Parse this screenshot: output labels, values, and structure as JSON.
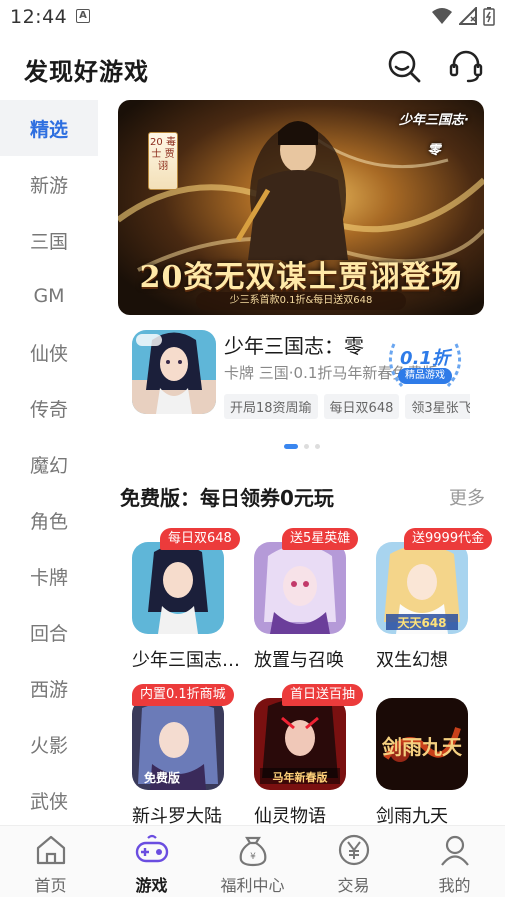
{
  "status_bar": {
    "time": "12:44",
    "notification_letter": "A"
  },
  "header": {
    "title": "发现好游戏"
  },
  "sidebar": {
    "items": [
      {
        "label": "精选",
        "active": true
      },
      {
        "label": "新游"
      },
      {
        "label": "三国"
      },
      {
        "label": "GM"
      },
      {
        "label": "仙侠"
      },
      {
        "label": "传奇"
      },
      {
        "label": "魔幻"
      },
      {
        "label": "角色"
      },
      {
        "label": "卡牌"
      },
      {
        "label": "回合"
      },
      {
        "label": "西游"
      },
      {
        "label": "火影"
      },
      {
        "label": "武侠"
      }
    ]
  },
  "banner": {
    "title": "20资无双谋士贾诩登场",
    "subtitle": "少三系首款0.1折&每日送双648",
    "badge": "20 毒士 贾诩",
    "logo": "少年三国志·零"
  },
  "featured": {
    "name": "少年三国志：零",
    "description": "卡牌 三国·0.1折马年新春免费版",
    "tags": [
      "开局18资周瑜",
      "每日双648",
      "领3星张飞"
    ],
    "discount": "0.1折",
    "discount_label": "精品游戏"
  },
  "carousel": {
    "pages": 3,
    "active": 0
  },
  "section": {
    "title": "免费版：每日领券0元玩",
    "more": "更多"
  },
  "games": [
    {
      "name": "少年三国志：零",
      "tag": "每日双648",
      "art_text": "免费版"
    },
    {
      "name": "放置与召唤",
      "tag": "送5星英雄",
      "art_text": ""
    },
    {
      "name": "双生幻想",
      "tag": "送9999代金",
      "art_text": "天天648"
    },
    {
      "name": "新斗罗大陆",
      "tag": "内置0.1折商城",
      "art_text": "免费版"
    },
    {
      "name": "仙灵物语",
      "tag": "首日送百抽",
      "art_text": "马年新春版"
    },
    {
      "name": "剑雨九天",
      "tag": "",
      "art_text": "剑雨九天"
    }
  ],
  "bottom_nav": {
    "items": [
      {
        "label": "首页",
        "icon": "home-icon"
      },
      {
        "label": "游戏",
        "icon": "gamepad-icon",
        "active": true
      },
      {
        "label": "福利中心",
        "icon": "gift-bag-icon"
      },
      {
        "label": "交易",
        "icon": "yen-icon"
      },
      {
        "label": "我的",
        "icon": "user-icon"
      }
    ]
  },
  "colors": {
    "accent": "#2e6fe0",
    "tag_red": "#ec3b3b",
    "sidebar_active_bg": "#f2f3f5"
  }
}
